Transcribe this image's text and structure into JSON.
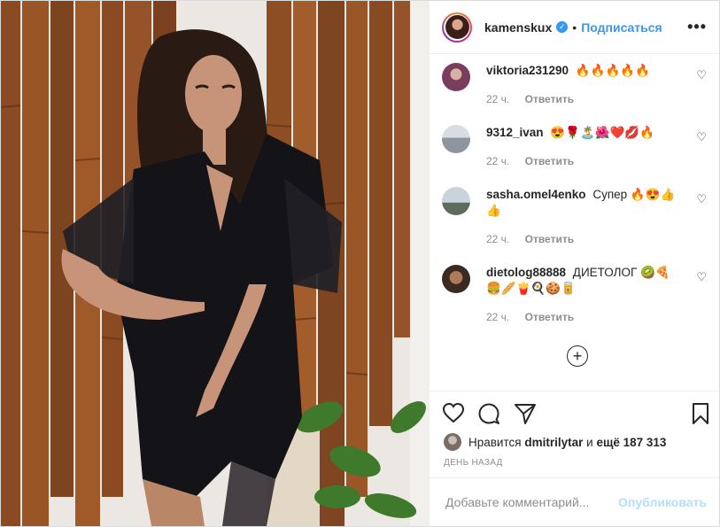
{
  "header": {
    "username": "kamenskux",
    "separator": "•",
    "follow_label": "Подписаться",
    "more_label": "•••"
  },
  "comments": [
    {
      "user": "viktoria231290",
      "text": "🔥🔥🔥🔥🔥",
      "time": "22 ч.",
      "reply": "Ответить"
    },
    {
      "user": "9312_ivan",
      "text": "😍🌹🏝️🌺❤️💋🔥",
      "time": "22 ч.",
      "reply": "Ответить"
    },
    {
      "user": "sasha.omel4enko",
      "text": "Супер 🔥😍👍👍",
      "time": "22 ч.",
      "reply": "Ответить"
    },
    {
      "user": "dietolog88888",
      "text": "ДИЕТОЛОГ 🥝🍕🍔🥖🍟🍳🍪🥫",
      "time": "22 ч.",
      "reply": "Ответить"
    }
  ],
  "load_more": "+",
  "likes": {
    "prefix": "Нравится",
    "user": "dmitrilytar",
    "middle": "и",
    "others": "ещё 187 313"
  },
  "date": "ДЕНЬ НАЗАД",
  "add_comment": {
    "placeholder": "Добавьте комментарий...",
    "publish_label": "Опубликовать"
  },
  "colors": {
    "accent": "#3897f0",
    "publish_disabled": "#b2dffc",
    "muted": "#8e8e8e"
  },
  "icons": [
    "heart-icon",
    "comment-icon",
    "share-icon",
    "bookmark-icon",
    "plus-circle-icon",
    "verified-icon",
    "more-icon"
  ]
}
